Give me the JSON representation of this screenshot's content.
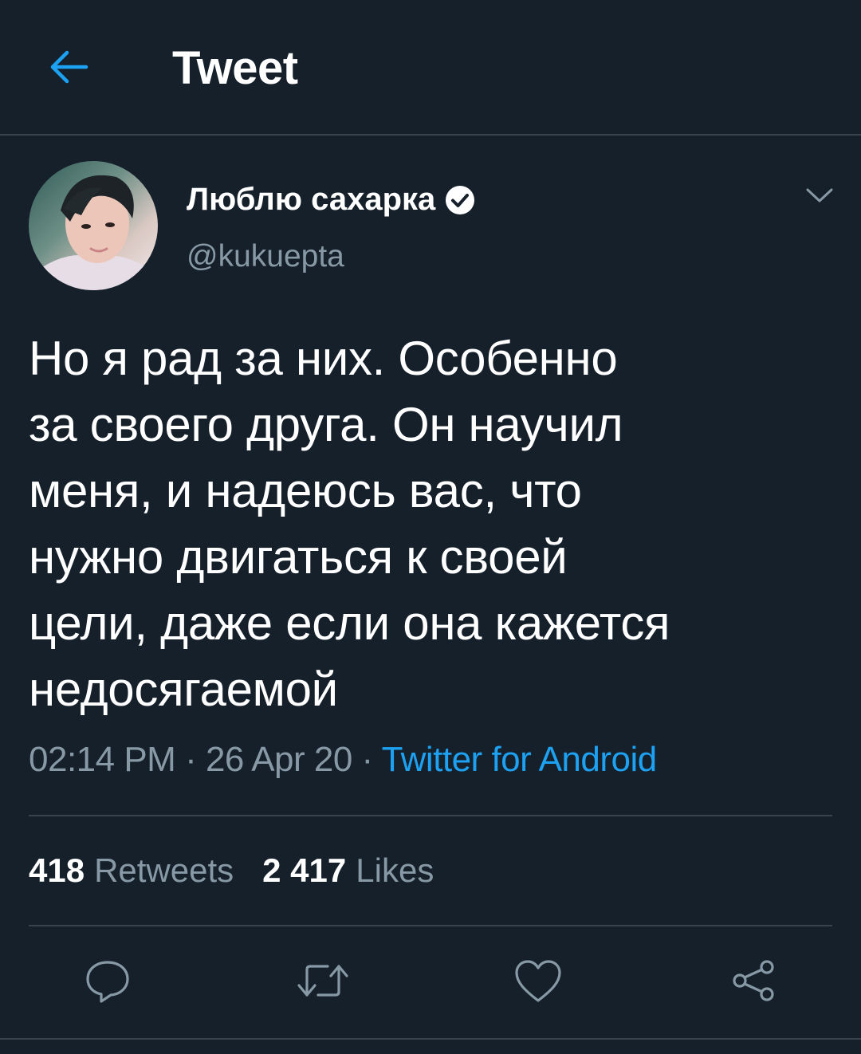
{
  "header": {
    "title": "Tweet"
  },
  "author": {
    "name": "Люблю сахарка",
    "handle": "@kukuepta"
  },
  "tweet": {
    "lines": [
      "Но я рад за них. Особенно",
      "за своего друга. Он научил",
      "меня, и надеюсь вас, что",
      "нужно двигаться к своей",
      "цели, даже если она кажется",
      "недосягаемой"
    ],
    "time": "02:14 PM",
    "sep": " · ",
    "date": "26 Apr 20",
    "source": "Twitter for Android"
  },
  "stats": {
    "retweets_count": "418",
    "retweets_label": "Retweets",
    "likes_count": "2 417",
    "likes_label": "Likes"
  },
  "colors": {
    "background": "#15202b",
    "accent": "#1da1f2",
    "muted": "#8899a6",
    "divider": "#38444d"
  },
  "icons": [
    "back-arrow-icon",
    "verified-badge-icon",
    "chevron-down-icon",
    "reply-icon",
    "retweet-icon",
    "like-icon",
    "share-icon"
  ]
}
